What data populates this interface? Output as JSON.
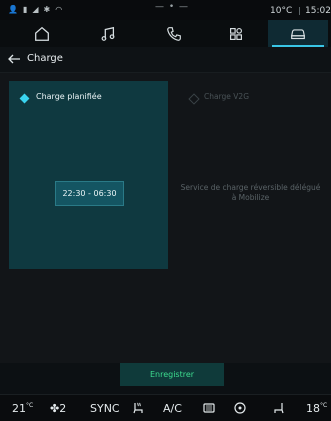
{
  "status_bar": {
    "temperature": "10°C",
    "time": "15:02",
    "dots": "— • —"
  },
  "nav": {
    "tabs": [
      {
        "icon": "home-icon",
        "active": false
      },
      {
        "icon": "music-icon",
        "active": false
      },
      {
        "icon": "phone-icon",
        "active": false
      },
      {
        "icon": "apps-icon",
        "active": false
      },
      {
        "icon": "car-icon",
        "active": true
      }
    ]
  },
  "header": {
    "title": "Charge"
  },
  "options": {
    "scheduled": {
      "label": "Charge planifiée",
      "time_range": "22:30 - 06:30",
      "selected": true
    },
    "v2g": {
      "label": "Charge V2G",
      "description": "Service de charge réversible délégué à Mobilize",
      "selected": false
    }
  },
  "save_label": "Enregistrer",
  "climate": {
    "left_temp": "21",
    "fan_level": "2",
    "sync_label": "SYNC",
    "ac_label": "A/C",
    "right_temp": "18",
    "deg_symbol": "°C"
  }
}
